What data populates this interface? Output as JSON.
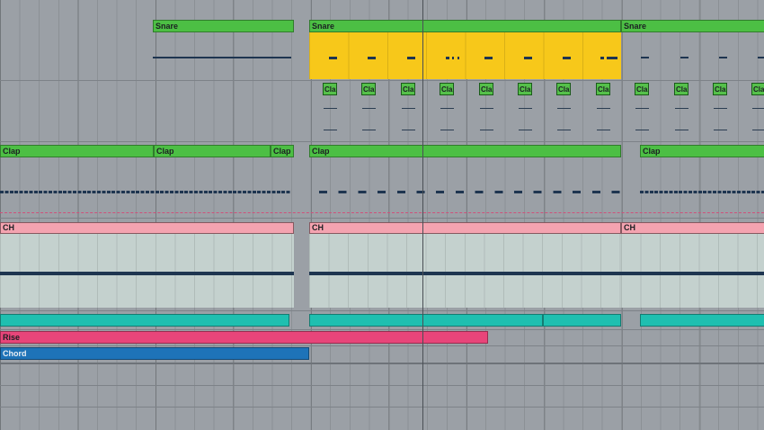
{
  "colors": {
    "green": "#4cbf44",
    "yellow": "#f5c518",
    "pink": "#f4a3b0",
    "pink_body": "#c3d0cd",
    "teal": "#1fbfb0",
    "magenta": "#e8457a",
    "blue": "#1e73b8",
    "playhead": "#4a4f55"
  },
  "tracks": {
    "snare": {
      "clips": [
        {
          "name": "Snare"
        },
        {
          "name": "Snare"
        },
        {
          "name": "Snare"
        }
      ]
    },
    "clap_small": {
      "clip_label": "Cla",
      "count": 12
    },
    "clap": {
      "clips": [
        {
          "name": "Clap"
        },
        {
          "name": "Clap"
        },
        {
          "name": "Clap"
        },
        {
          "name": "Clap"
        },
        {
          "name": "Clap"
        }
      ]
    },
    "ch": {
      "clips": [
        {
          "name": "CH"
        },
        {
          "name": "CH"
        },
        {
          "name": "CH"
        }
      ]
    },
    "teal": {
      "clips": [
        {
          "name": ""
        },
        {
          "name": ""
        },
        {
          "name": ""
        },
        {
          "name": ""
        }
      ]
    },
    "rise": {
      "name": "Rise"
    },
    "chord": {
      "name": "Chord"
    }
  }
}
